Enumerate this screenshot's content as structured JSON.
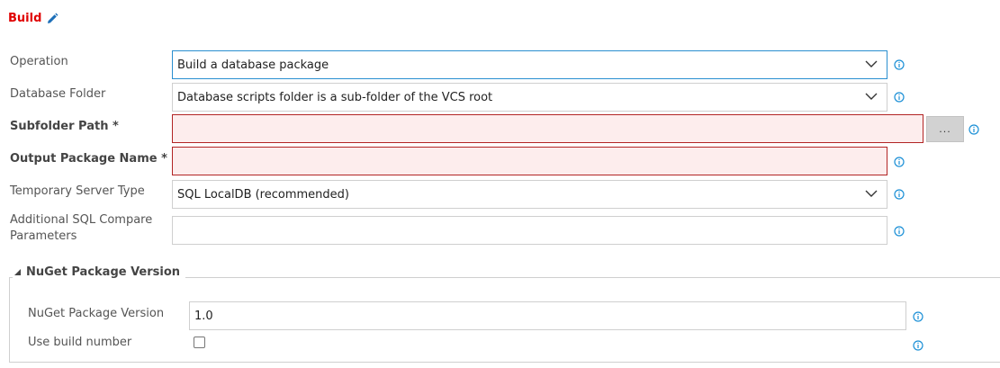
{
  "header": {
    "title": "Build",
    "edit_icon": "pencil-icon"
  },
  "form": {
    "operation": {
      "label": "Operation",
      "value": "Build a database package"
    },
    "database_folder": {
      "label": "Database Folder",
      "value": "Database scripts folder is a sub-folder of the VCS root"
    },
    "subfolder_path": {
      "label": "Subfolder Path *",
      "value": "",
      "browse_label": "..."
    },
    "output_package_name": {
      "label": "Output Package Name *",
      "value": ""
    },
    "temp_server_type": {
      "label": "Temporary Server Type",
      "value": "SQL LocalDB (recommended)"
    },
    "additional_params": {
      "label_line1": "Additional SQL Compare",
      "label_line2": "Parameters",
      "value": ""
    }
  },
  "nuget": {
    "legend": "NuGet Package Version",
    "version": {
      "label": "NuGet Package Version",
      "value": "1.0"
    },
    "use_build_number": {
      "label": "Use build number",
      "checked": false
    }
  },
  "icons": {
    "info": "info-icon",
    "dropdown": "chevron-down-icon",
    "collapse": "collapse-triangle-icon"
  },
  "colors": {
    "title": "#e00000",
    "info": "#1a8fd6",
    "error_border": "#b22424",
    "error_bg": "#fdeded",
    "focus_border": "#2a8fd0"
  }
}
